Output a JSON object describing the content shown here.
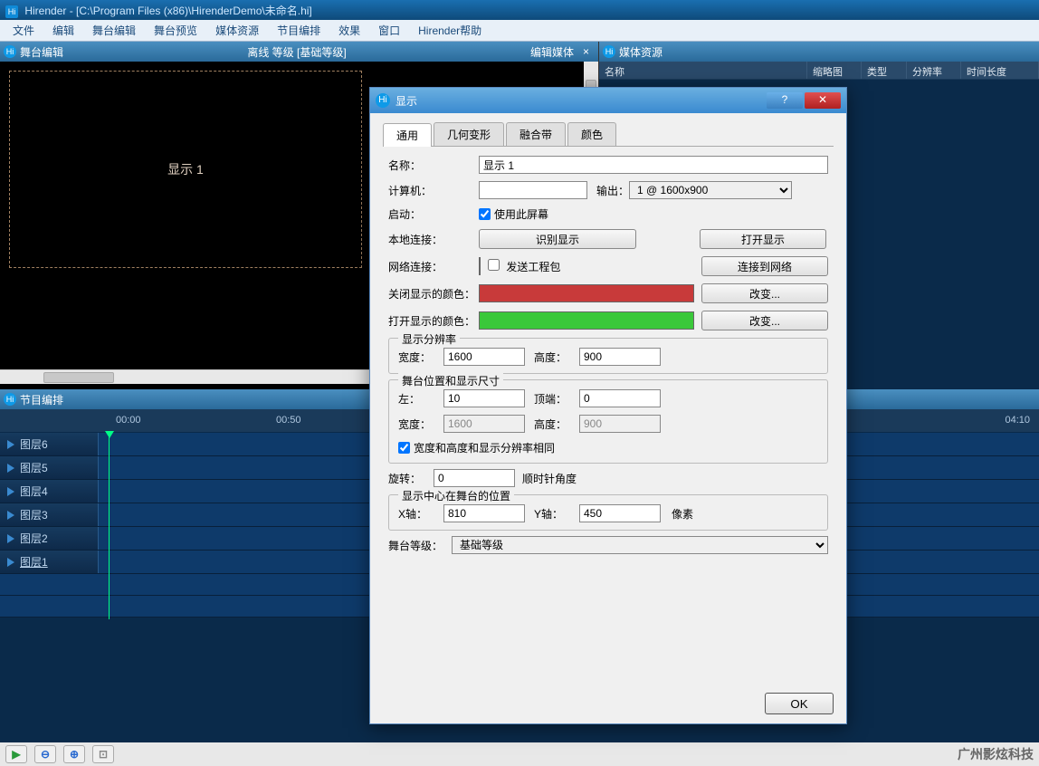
{
  "window_title": "Hirender - [C:\\Program Files (x86)\\HirenderDemo\\未命名.hi]",
  "menu": [
    "文件",
    "编辑",
    "舞台编辑",
    "舞台预览",
    "媒体资源",
    "节目编排",
    "效果",
    "窗口",
    "Hirender帮助"
  ],
  "stage_panel": {
    "title": "舞台编辑",
    "center": "离线  等级 [基础等级]",
    "right": "编辑媒体",
    "display_name": "显示  1"
  },
  "media_panel": {
    "title": "媒体资源",
    "columns": [
      "名称",
      "缩略图",
      "类型",
      "分辨率",
      "时间长度"
    ]
  },
  "timeline_panel": {
    "title": "节目编排",
    "times": {
      "t1": "00:00",
      "t2": "00:50",
      "t3": "04:10"
    },
    "layers": [
      "图层6",
      "图层5",
      "图层4",
      "图层3",
      "图层2",
      "图层1"
    ]
  },
  "watermark": "广州影炫科技",
  "dialog": {
    "title": "显示",
    "tabs": [
      "通用",
      "几何变形",
      "融合带",
      "颜色"
    ],
    "labels": {
      "name": "名称：",
      "computer": "计算机：",
      "output": "输出：",
      "enable": "启动：",
      "use_screen": "使用此屏幕",
      "local_conn": "本地连接：",
      "identify": "识别显示",
      "open_disp": "打开显示",
      "net_conn": "网络连接：",
      "send_proj": "发送工程包",
      "conn_net": "连接到网络",
      "closed_color": "关闭显示的颜色：",
      "open_color": "打开显示的颜色：",
      "change": "改变...",
      "resolution_fs": "显示分辨率",
      "width": "宽度：",
      "height": "高度：",
      "stage_pos_fs": "舞台位置和显示尺寸",
      "left": "左：",
      "top": "顶端：",
      "lock_wh": "宽度和高度和显示分辨率相同",
      "rotate": "旋转：",
      "cw_deg": "顺时针角度",
      "center_fs": "显示中心在舞台的位置",
      "x_axis": "X轴：",
      "y_axis": "Y轴：",
      "pixel": "像素",
      "stage_level": "舞台等级：",
      "ok": "OK"
    },
    "values": {
      "name": "显示 1",
      "computer": "",
      "output": "1 @ 1600x900",
      "res_w": "1600",
      "res_h": "900",
      "pos_left": "10",
      "pos_top": "0",
      "pos_w": "1600",
      "pos_h": "900",
      "rotate": "0",
      "center_x": "810",
      "center_y": "450",
      "stage_level": "基础等级"
    },
    "colors": {
      "net_swatch": "#e00000",
      "closed_swatch": "#c83a3a",
      "open_swatch": "#3ac83a"
    }
  }
}
